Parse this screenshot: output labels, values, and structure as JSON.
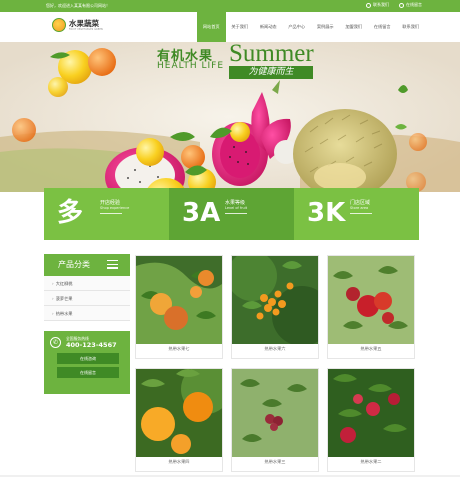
{
  "topbar": {
    "welcome": "您好，欢迎进入某某有限公司网站！",
    "link_contact": "联系我们",
    "link_online": "在线留言"
  },
  "header": {
    "logo_cn": "水果蔬菜",
    "logo_en": "FRUIT VEGETABLES GREEN",
    "nav": [
      "网站首页",
      "关于我们",
      "新闻动态",
      "产品中心",
      "案例展示",
      "加盟我们",
      "在线留言",
      "联系我们"
    ]
  },
  "banner": {
    "title_cn": "有机水果",
    "title_en": "Summer",
    "sub_en": "HEALTH LIFE",
    "sub_cn": "为健康而生"
  },
  "stats": [
    {
      "big": "多",
      "label": "开店经验",
      "en": "Shop experience"
    },
    {
      "big": "3A",
      "label": "水果等级",
      "en": "Level of fruit"
    },
    {
      "big": "3K",
      "label": "门店区域",
      "en": "Store area"
    }
  ],
  "sidebar": {
    "title": "产品分类",
    "items": [
      "大红柳桃",
      "菠萝芒果",
      "热带水果"
    ],
    "hotline_label": "全国服务热线",
    "phone": "400-123-4567",
    "btn_consult": "在线咨询",
    "btn_message": "在线留言"
  },
  "products": [
    {
      "name": "热带水果七"
    },
    {
      "name": "热带水果六"
    },
    {
      "name": "热带水果五"
    },
    {
      "name": "热带水果四"
    },
    {
      "name": "热带水果三"
    },
    {
      "name": "热带水果二"
    }
  ],
  "colors": {
    "brand_green": "#6db33f",
    "dark_green": "#3f8a25"
  }
}
